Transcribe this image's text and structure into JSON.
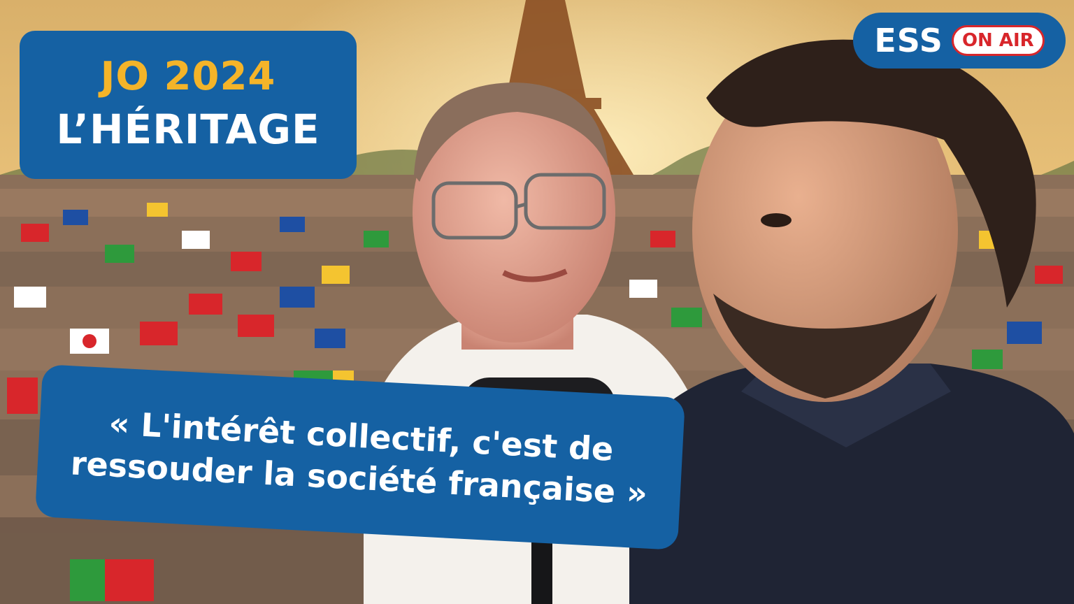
{
  "title": {
    "line1": "JO 2024",
    "line2": "L’HÉRITAGE"
  },
  "logo": {
    "word": "ESS",
    "badge": "ON AIR"
  },
  "quote": {
    "text": "« L'intérêt collectif, c'est de ressouder la société française »"
  },
  "colors": {
    "panel_blue": "#1561a3",
    "title_gold": "#f4b429",
    "badge_red": "#d8262b"
  }
}
